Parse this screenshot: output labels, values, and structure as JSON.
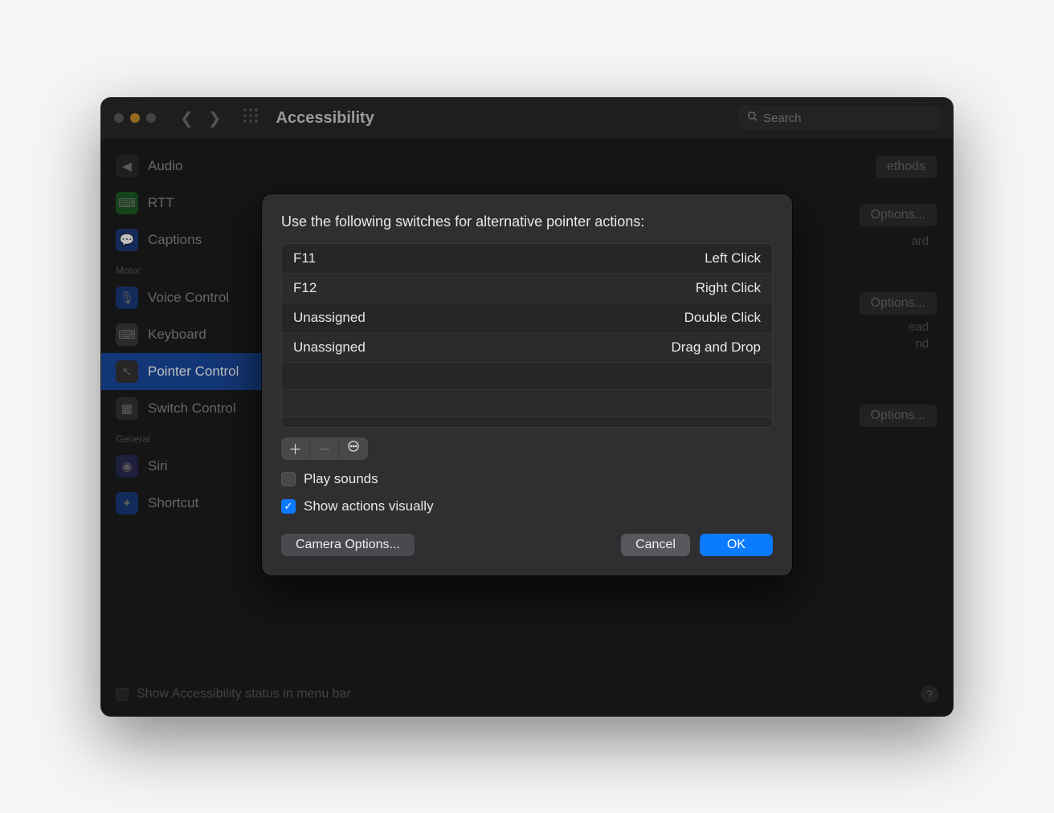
{
  "window": {
    "title": "Accessibility",
    "search_placeholder": "Search"
  },
  "sidebar": {
    "sections": [
      {
        "label": "",
        "items": [
          {
            "label": "Audio",
            "icon": "audio"
          },
          {
            "label": "RTT",
            "icon": "rtt"
          },
          {
            "label": "Captions",
            "icon": "captions"
          }
        ]
      },
      {
        "label": "Motor",
        "items": [
          {
            "label": "Voice Control",
            "icon": "voice"
          },
          {
            "label": "Keyboard",
            "icon": "keyboard"
          },
          {
            "label": "Pointer Control",
            "icon": "pointer",
            "selected": true
          },
          {
            "label": "Switch Control",
            "icon": "switch"
          }
        ]
      },
      {
        "label": "General",
        "items": [
          {
            "label": "Siri",
            "icon": "siri"
          },
          {
            "label": "Shortcut",
            "icon": "shortcut"
          }
        ]
      }
    ]
  },
  "background_buttons": {
    "methods": "ethods",
    "options1": "Options...",
    "options2": "Options...",
    "options3": "Options...",
    "text_ard": "ard",
    "text_ead": "ead",
    "text_nd": "nd"
  },
  "footer": {
    "checkbox_label": "Show Accessibility status in menu bar"
  },
  "sheet": {
    "heading": "Use the following switches for alternative pointer actions:",
    "rows": [
      {
        "key": "F11",
        "action": "Left Click"
      },
      {
        "key": "F12",
        "action": "Right Click"
      },
      {
        "key": "Unassigned",
        "action": "Double Click"
      },
      {
        "key": "Unassigned",
        "action": "Drag and Drop"
      }
    ],
    "play_sounds_label": "Play sounds",
    "play_sounds_checked": false,
    "show_actions_label": "Show actions visually",
    "show_actions_checked": true,
    "camera_options_label": "Camera Options...",
    "cancel_label": "Cancel",
    "ok_label": "OK"
  }
}
